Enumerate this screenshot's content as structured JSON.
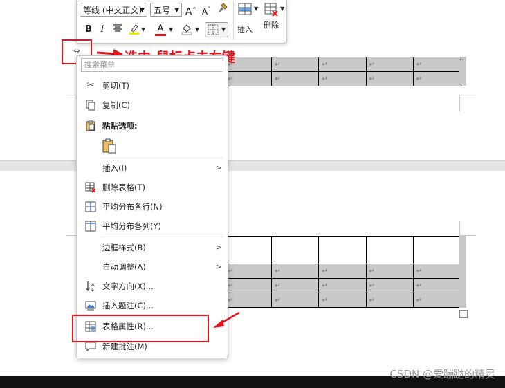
{
  "mini_toolbar": {
    "font_name": "等线 (中文正文)",
    "font_size": "五号",
    "grow_font": "A",
    "shrink_font": "A",
    "bold": "B",
    "italic": "I",
    "font_color_letter": "A",
    "insert_label": "插入",
    "delete_label": "删除"
  },
  "context_menu": {
    "search_placeholder": "搜索菜单",
    "items": [
      {
        "label": "剪切(T)",
        "icon": "scissors-icon"
      },
      {
        "label": "复制(C)",
        "icon": "copy-icon"
      },
      {
        "label": "粘贴选项:",
        "icon": "clipboard-icon"
      },
      {
        "label": "插入(I)",
        "icon": "",
        "submenu": true
      },
      {
        "label": "删除表格(T)",
        "icon": "delete-table-icon"
      },
      {
        "label": "平均分布各行(N)",
        "icon": "distribute-rows-icon"
      },
      {
        "label": "平均分布各列(Y)",
        "icon": "distribute-columns-icon"
      },
      {
        "label": "边框样式(B)",
        "icon": "",
        "submenu": true
      },
      {
        "label": "自动调整(A)",
        "icon": "",
        "submenu": true
      },
      {
        "label": "文字方向(X)...",
        "icon": "text-direction-icon"
      },
      {
        "label": "插入题注(C)...",
        "icon": "insert-caption-icon"
      },
      {
        "label": "表格属性(R)...",
        "icon": "table-properties-icon"
      },
      {
        "label": "新建批注(M)",
        "icon": "new-comment-icon"
      }
    ]
  },
  "annotation": "选中-鼠标点击右键",
  "cell_mark": "↵",
  "watermark": "CSDN @爱蹦跶的精灵",
  "colors": {
    "annotation_red": "#e8141c",
    "selection_gray": "#c9c9c9"
  }
}
